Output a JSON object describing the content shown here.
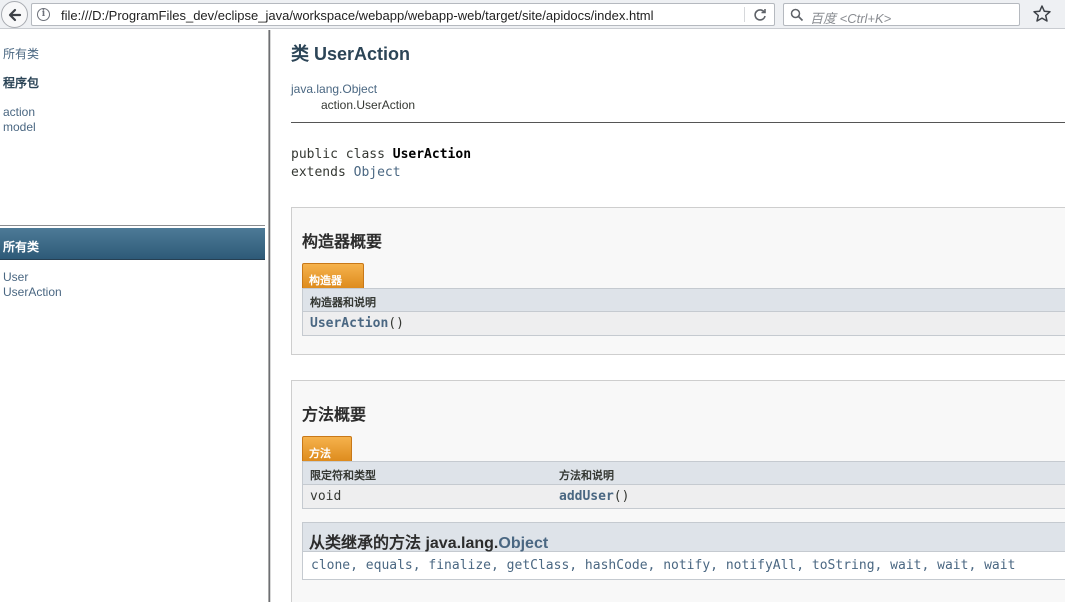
{
  "browser": {
    "url": "file:///D:/ProgramFiles_dev/eclipse_java/workspace/webapp/webapp-web/target/site/apidocs/index.html",
    "search_placeholder": "百度 <Ctrl+K>",
    "icons": [
      "back-arrow-icon",
      "info-icon",
      "reload-icon",
      "search-icon",
      "bookmark-star-icon"
    ]
  },
  "left_frame": {
    "all_classes_link": "所有类",
    "packages_heading": "程序包",
    "packages": [
      "action",
      "model"
    ],
    "classes_bar_title": "所有类",
    "classes": [
      "User",
      "UserAction"
    ]
  },
  "main": {
    "class_title": "类 UserAction",
    "inheritance": {
      "super": "java.lang.Object",
      "sub": "action.UserAction"
    },
    "signature": {
      "line1_prefix": "public class ",
      "line1_name": "UserAction",
      "line2_prefix": "extends ",
      "line2_link": "Object"
    },
    "constructor_summary": {
      "title": "构造器概要",
      "tab_label": "构造器",
      "column_header": "构造器和说明",
      "rows": [
        {
          "name": "UserAction",
          "suffix": "()"
        }
      ]
    },
    "method_summary": {
      "title": "方法概要",
      "tab_label": "方法",
      "column_headers": [
        "限定符和类型",
        "方法和说明"
      ],
      "rows": [
        {
          "type": "void",
          "name": "addUser",
          "suffix": "()"
        }
      ],
      "inherited": {
        "prefix": "从类继承的方法 java.lang.",
        "class_link": "Object",
        "methods": "clone, equals, finalize, getClass, hashCode, notify, notifyAll, toString, wait, wait, wait"
      }
    }
  }
}
